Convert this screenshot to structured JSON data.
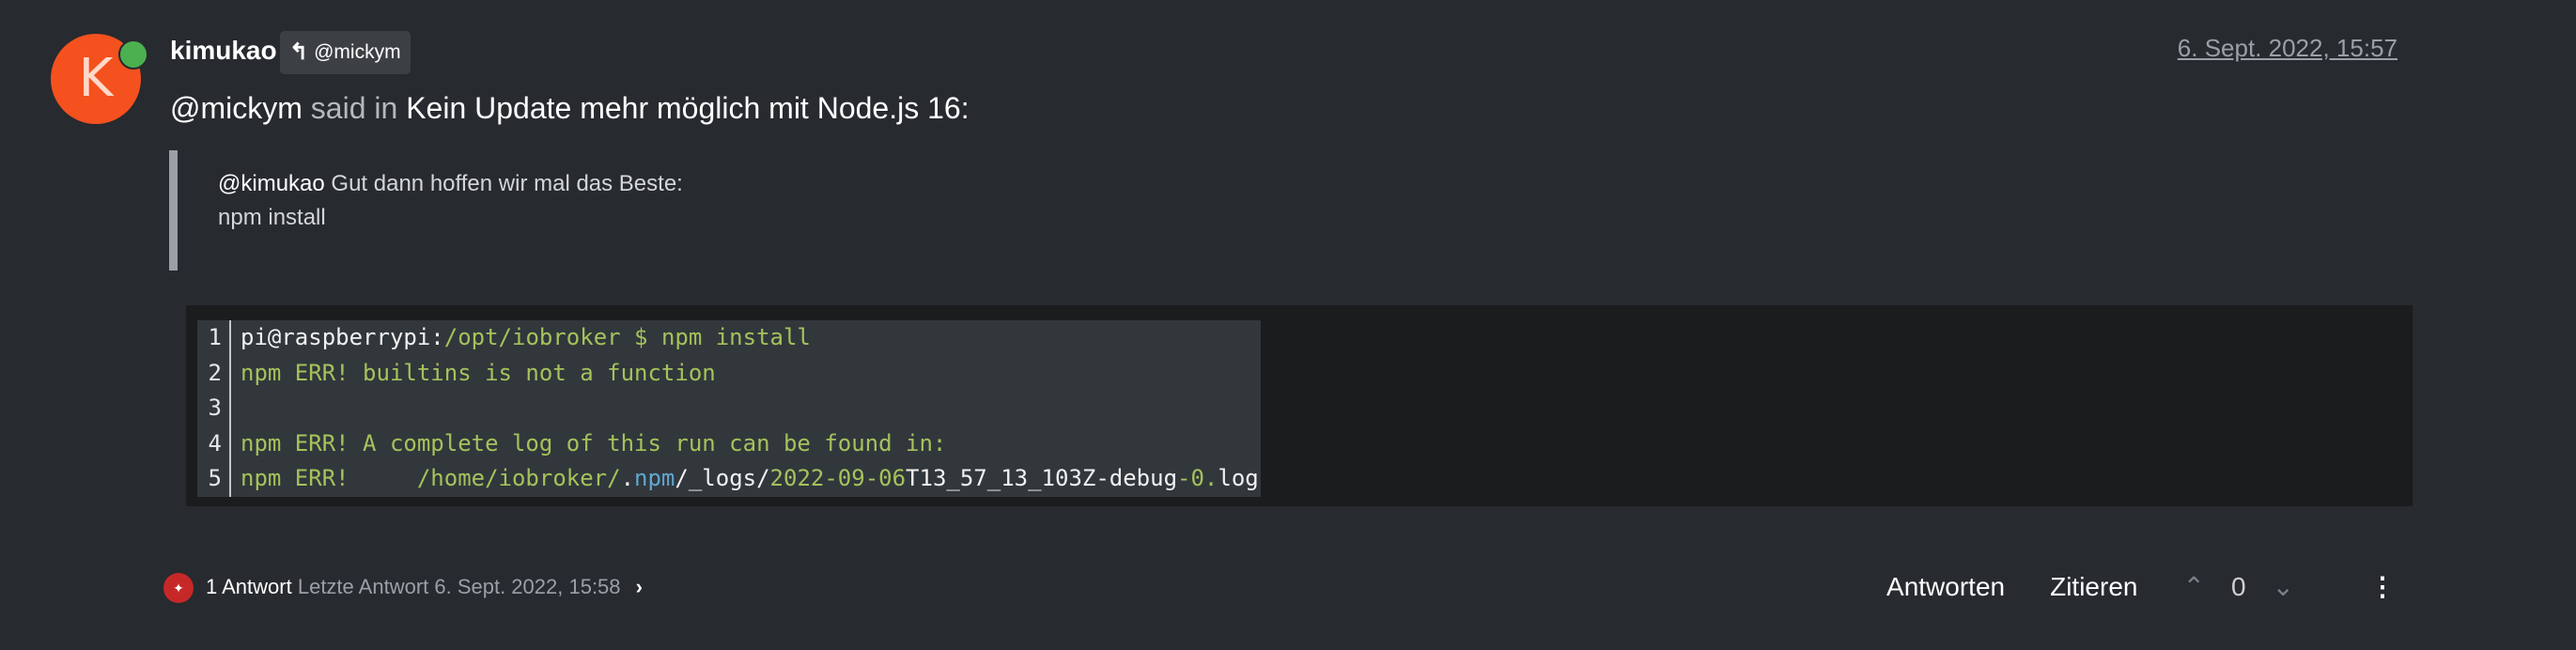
{
  "post": {
    "avatar_letter": "K",
    "avatar_color": "#f4511e",
    "online_color": "#4caf50",
    "author": "kimukao",
    "reply_to": "@mickym",
    "timestamp": "6. Sept. 2022, 15:57"
  },
  "header": {
    "mention": "@mickym",
    "said_in": "said in",
    "topic": "Kein Update mehr möglich mit Node.js 16",
    "colon": ":"
  },
  "quote": {
    "mention": "@kimukao",
    "text": " Gut dann hoffen wir mal das Beste:",
    "line2": "npm install"
  },
  "code": {
    "lines": [
      {
        "n": "1",
        "parts": [
          [
            "white",
            "pi@raspberrypi:"
          ],
          [
            "green",
            "/opt/iobroker $ npm install"
          ]
        ]
      },
      {
        "n": "2",
        "parts": [
          [
            "green",
            "npm ERR! builtins is not a function"
          ]
        ]
      },
      {
        "n": "3",
        "parts": [
          [
            "white",
            " "
          ]
        ]
      },
      {
        "n": "4",
        "parts": [
          [
            "green",
            "npm ERR! A complete log of this run can be found in:"
          ]
        ]
      },
      {
        "n": "5",
        "parts": [
          [
            "green",
            "npm ERR!     /home/iobroker/"
          ],
          [
            "white",
            "."
          ],
          [
            "blue",
            "npm"
          ],
          [
            "white",
            "/_logs/"
          ],
          [
            "green",
            "2022-09-06"
          ],
          [
            "white",
            "T13_57_13_103Z-debug"
          ],
          [
            "green",
            "-0."
          ],
          [
            "white",
            "log"
          ]
        ]
      }
    ]
  },
  "footer": {
    "replies": "1 Antwort",
    "last_reply": "Letzte Antwort 6. Sept. 2022, 15:58",
    "reply_label": "Antworten",
    "quote_label": "Zitieren",
    "votes": "0"
  }
}
